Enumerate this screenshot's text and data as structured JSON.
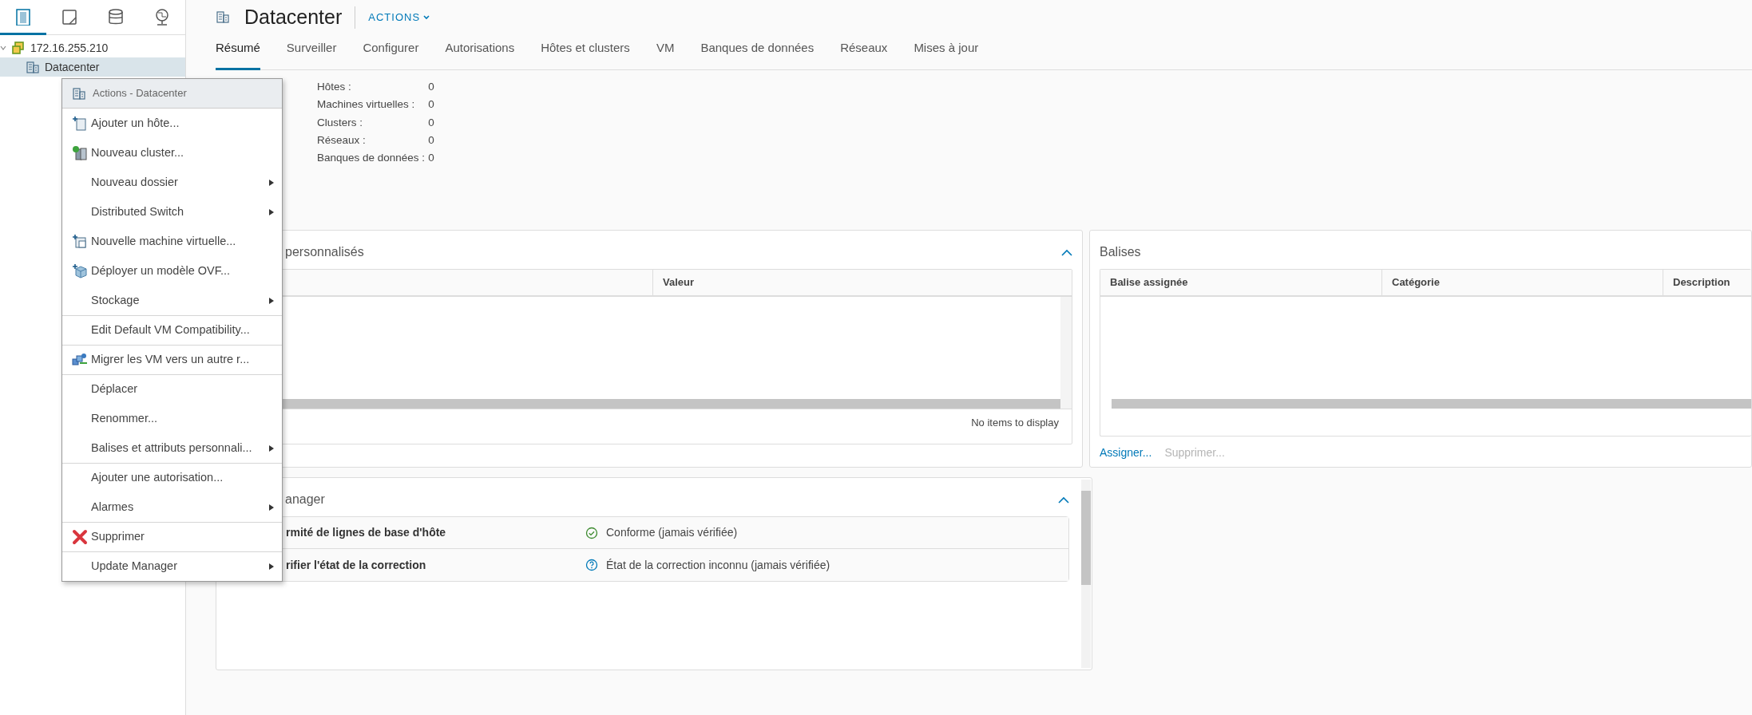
{
  "sidebar": {
    "icon_tabs": [
      {
        "kind": "hosts",
        "selected": true
      },
      {
        "kind": "vms",
        "selected": false
      },
      {
        "kind": "storage",
        "selected": false
      },
      {
        "kind": "network",
        "selected": false
      }
    ],
    "tree": [
      {
        "label": "172.16.255.210",
        "kind": "vcenter",
        "expanded": true,
        "selected": false,
        "children": [
          {
            "label": "Datacenter",
            "kind": "datacenter",
            "selected": true
          }
        ]
      }
    ]
  },
  "header": {
    "title": "Datacenter",
    "actions": "ACTIONS"
  },
  "tabs": [
    {
      "label": "Résumé",
      "selected": true
    },
    {
      "label": "Surveiller",
      "selected": false
    },
    {
      "label": "Configurer",
      "selected": false
    },
    {
      "label": "Autorisations",
      "selected": false
    },
    {
      "label": "Hôtes et clusters",
      "selected": false
    },
    {
      "label": "VM",
      "selected": false
    },
    {
      "label": "Banques de données",
      "selected": false
    },
    {
      "label": "Réseaux",
      "selected": false
    },
    {
      "label": "Mises à jour",
      "selected": false
    }
  ],
  "summary": [
    {
      "label": "Hôtes :",
      "value": "0"
    },
    {
      "label": "Machines virtuelles :",
      "value": "0"
    },
    {
      "label": "Clusters :",
      "value": "0"
    },
    {
      "label": "Réseaux :",
      "value": "0"
    },
    {
      "label": "Banques de données :",
      "value": "0"
    }
  ],
  "custom_attributes": {
    "title": "personnalisés",
    "expanded": true,
    "columns": [
      "Valeur"
    ],
    "footer": "No items to display"
  },
  "tags": {
    "title": "Balises",
    "columns": [
      "Balise assignée",
      "Catégorie",
      "Description"
    ],
    "actions": [
      {
        "label": "Assigner...",
        "disabled": false
      },
      {
        "label": "Supprimer...",
        "disabled": true
      }
    ]
  },
  "update_manager": {
    "title": "anager",
    "expanded": true,
    "rows": [
      {
        "label": "rmité de lignes de base d'hôte",
        "status": "Conforme (jamais vérifiée)",
        "kind": "ok"
      },
      {
        "label": "rifier l'état de la correction",
        "status": "État de la correction inconnu (jamais vérifiée)",
        "kind": "unknown"
      }
    ]
  },
  "context_menu": {
    "title": "Actions - Datacenter",
    "items": [
      {
        "label": "Ajouter un hôte...",
        "kind": "add-host",
        "submenu": false,
        "separator_before": false
      },
      {
        "label": "Nouveau cluster...",
        "kind": "cluster",
        "submenu": false,
        "separator_before": false
      },
      {
        "label": "Nouveau dossier",
        "submenu": true,
        "separator_before": false
      },
      {
        "label": "Distributed Switch",
        "submenu": true,
        "separator_before": false
      },
      {
        "label": "Nouvelle machine virtuelle...",
        "kind": "new-vm",
        "submenu": false,
        "separator_before": false
      },
      {
        "label": "Déployer un modèle OVF...",
        "kind": "ovf",
        "submenu": false,
        "separator_before": false
      },
      {
        "label": "Stockage",
        "submenu": true,
        "separator_before": false
      },
      {
        "label": "Edit Default VM Compatibility...",
        "submenu": false,
        "separator_before": true
      },
      {
        "label": "Migrer les VM vers un autre r...",
        "kind": "migrate",
        "submenu": false,
        "separator_before": true
      },
      {
        "label": "Déplacer",
        "submenu": false,
        "separator_before": true
      },
      {
        "label": "Renommer...",
        "submenu": false,
        "separator_before": false
      },
      {
        "label": "Balises et attributs personnali...",
        "submenu": true,
        "separator_before": false
      },
      {
        "label": "Ajouter une autorisation...",
        "submenu": false,
        "separator_before": true
      },
      {
        "label": "Alarmes",
        "submenu": true,
        "separator_before": false
      },
      {
        "label": "Supprimer",
        "kind": "delete",
        "submenu": false,
        "separator_before": true
      },
      {
        "label": "Update Manager",
        "submenu": true,
        "separator_before": true
      }
    ]
  }
}
